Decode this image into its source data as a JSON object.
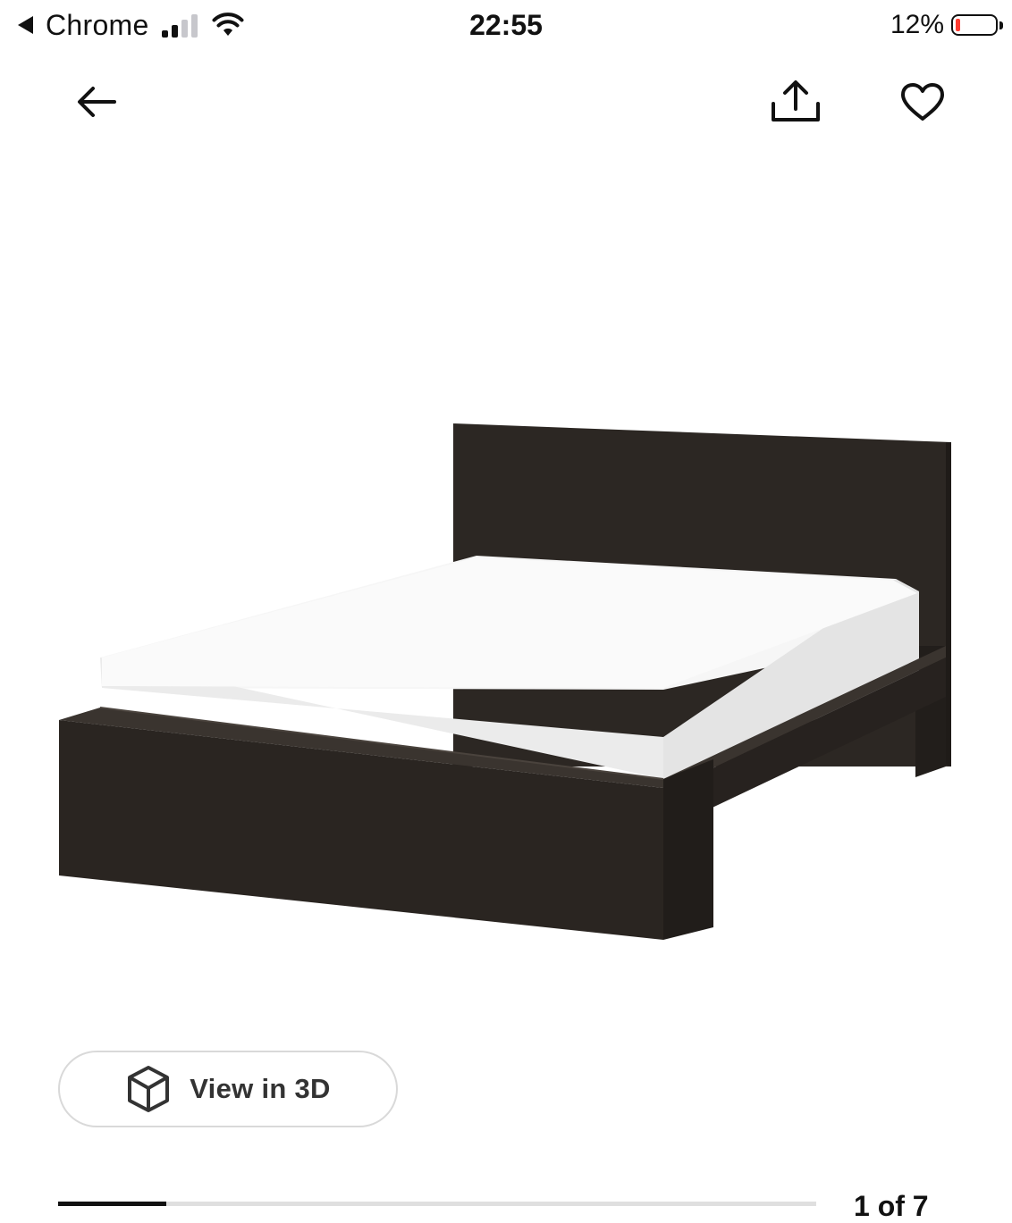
{
  "status_bar": {
    "back_app": "Chrome",
    "time": "22:55",
    "battery_percent": "12%",
    "battery_level": 0.12,
    "signal_bars_on": 2,
    "signal_bars_total": 4,
    "battery_color": "#ff3b30"
  },
  "top_bar": {
    "back_icon": "arrow-left-icon",
    "share_icon": "share-icon",
    "favorite_icon": "heart-icon"
  },
  "product": {
    "image_icon": "bed-photo"
  },
  "view3d": {
    "icon": "cube-icon",
    "label": "View in 3D"
  },
  "gallery": {
    "counter": "1 of 7",
    "current": 1,
    "total": 7
  }
}
